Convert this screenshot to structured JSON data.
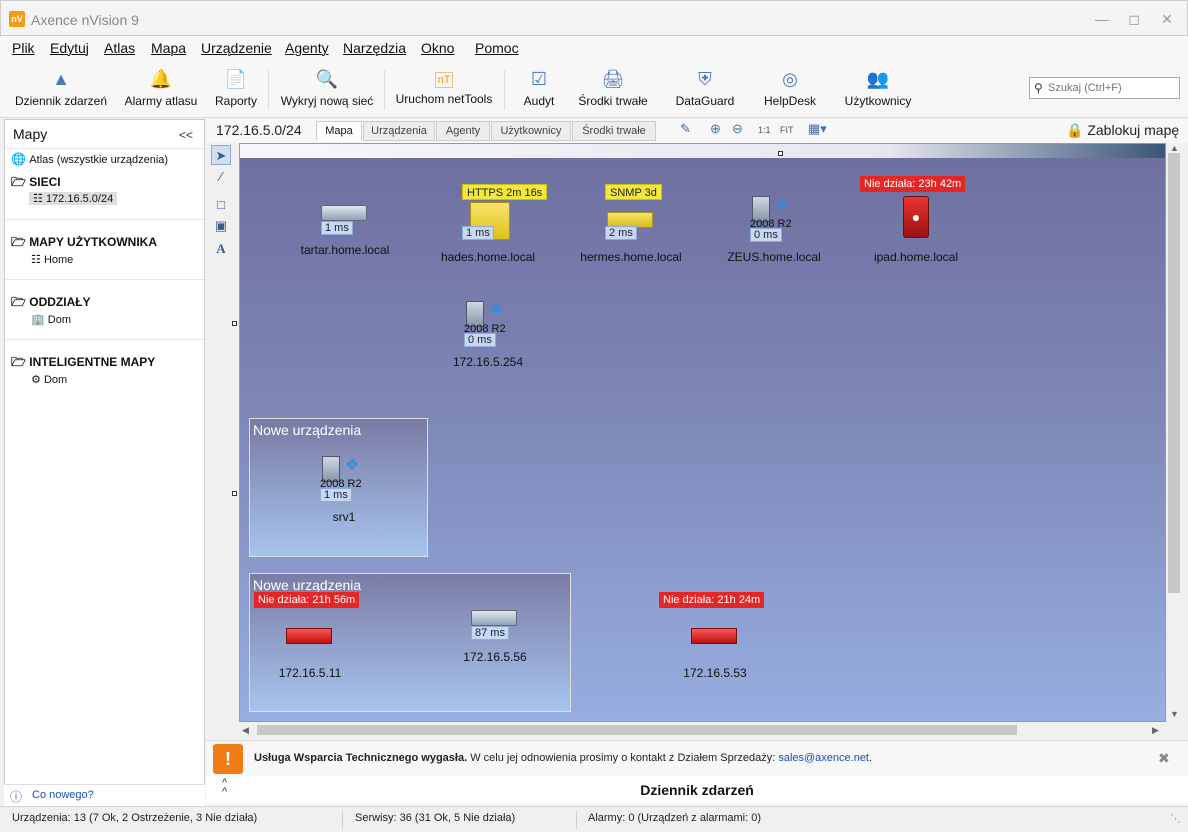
{
  "window": {
    "title": "Axence nVision 9",
    "logo": "nV"
  },
  "menu": [
    "Plik",
    "Edytuj",
    "Atlas",
    "Mapa",
    "Urządzenie",
    "Agenty",
    "Narzędzia",
    "Okno",
    "Pomoc"
  ],
  "toolbar": {
    "event_log": "Dziennik zdarzeń",
    "atlas_alarms": "Alarmy atlasu",
    "reports": "Raporty",
    "discover": "Wykryj nową sieć",
    "nettools": "Uruchom netTools",
    "audit": "Audyt",
    "assets": "Środki trwałe",
    "dataguard": "DataGuard",
    "helpdesk": "HelpDesk",
    "users": "Użytkownicy",
    "search_placeholder": "Szukaj (Ctrl+F)"
  },
  "left_panel": {
    "title": "Mapy",
    "collapse": "<<",
    "atlas": "Atlas (wszystkie urządzenia)",
    "sections": [
      {
        "name": "SIECI",
        "child": "172.16.5.0/24"
      },
      {
        "name": "MAPY UŻYTKOWNIKA",
        "child": "Home"
      },
      {
        "name": "ODDZIAŁY",
        "child": "Dom"
      },
      {
        "name": "INTELIGENTNE MAPY",
        "child": "Dom"
      }
    ],
    "whats_new": "Co nowego?"
  },
  "map_header": {
    "network": "172.16.5.0/24",
    "tabs": [
      "Mapa",
      "Urządzenia",
      "Agenty",
      "Użytkownicy",
      "Środki trwałe"
    ],
    "zoom_1to1": "1:1",
    "zoom_fit": "FIT",
    "lock": "Zablokuj mapę"
  },
  "devices": [
    {
      "name": "tartar.home.local",
      "latency": "1 ms",
      "badge": "",
      "os": ""
    },
    {
      "name": "hades.home.local",
      "latency": "1 ms",
      "badge": "HTTPS 2m 16s",
      "os": ""
    },
    {
      "name": "hermes.home.local",
      "latency": "2 ms",
      "badge": "SNMP 3d",
      "os": ""
    },
    {
      "name": "ZEUS.home.local",
      "latency": "0 ms",
      "badge": "",
      "os": "2008 R2"
    },
    {
      "name": "ipad.home.local",
      "latency": "",
      "badge": "Nie działa: 23h 42m",
      "os": ""
    },
    {
      "name": "172.16.5.254",
      "latency": "0 ms",
      "badge": "",
      "os": "2008 R2"
    },
    {
      "name": "srv1",
      "latency": "1 ms",
      "badge": "",
      "os": "2008 R2"
    },
    {
      "name": "172.16.5.11",
      "latency": "",
      "badge": "Nie działa: 21h 56m",
      "os": ""
    },
    {
      "name": "172.16.5.56",
      "latency": "87 ms",
      "badge": "",
      "os": ""
    },
    {
      "name": "172.16.5.53",
      "latency": "",
      "badge": "Nie działa: 21h 24m",
      "os": ""
    }
  ],
  "groups": [
    "Nowe urządzenia",
    "Nowe urządzenia"
  ],
  "notice": {
    "bold": "Usługa Wsparcia Technicznego wygasła.",
    "text": " W celu jej odnowienia prosimy o kontakt z Działem Sprzedaży: ",
    "email": "sales@axence.net",
    "end": "."
  },
  "log_title": "Dziennik zdarzeń",
  "status": {
    "devices": "Urządzenia: 13 (7 Ok, 2 Ostrzeżenie, 3 Nie działa)",
    "services": "Serwisy: 36 (31 Ok, 5 Nie działa)",
    "alarms": "Alarmy: 0 (Urządzeń z alarmami: 0)"
  },
  "colors": {
    "warning_badge": "#f1e83a",
    "down_badge": "#e32626",
    "accent": "#4a7ab8",
    "notice": "#ef7d13"
  }
}
